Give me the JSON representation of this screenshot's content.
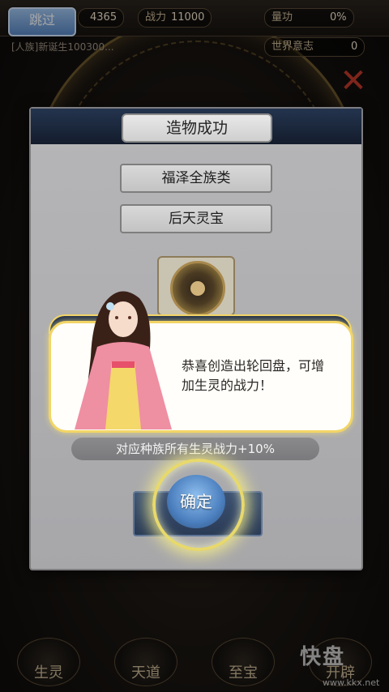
{
  "top": {
    "skip_label": "跳过",
    "resource_value": "4365",
    "power_label": "战力",
    "power_value": "11000",
    "merit_label": "量功",
    "merit_value": "0%",
    "will_label": "世界意志",
    "will_value": "0",
    "news": "[人族]新诞生100300..."
  },
  "modal": {
    "title": "造物成功",
    "category": "福泽全族类",
    "type": "后天灵宝",
    "dialogue": "恭喜创造出轮回盘，可增加生灵的战力！",
    "effect": "对应种族所有生灵战力+10%",
    "confirm_label": "确定"
  },
  "nav": {
    "items": [
      "生灵",
      "天道",
      "至宝",
      "开辟"
    ]
  },
  "watermark": {
    "logo": "快盘",
    "url": "www.kkx.net"
  },
  "colors": {
    "accent_gold": "#f2d566",
    "confirm_blue": "#4b7fbe",
    "close_red": "#c23a2a"
  }
}
